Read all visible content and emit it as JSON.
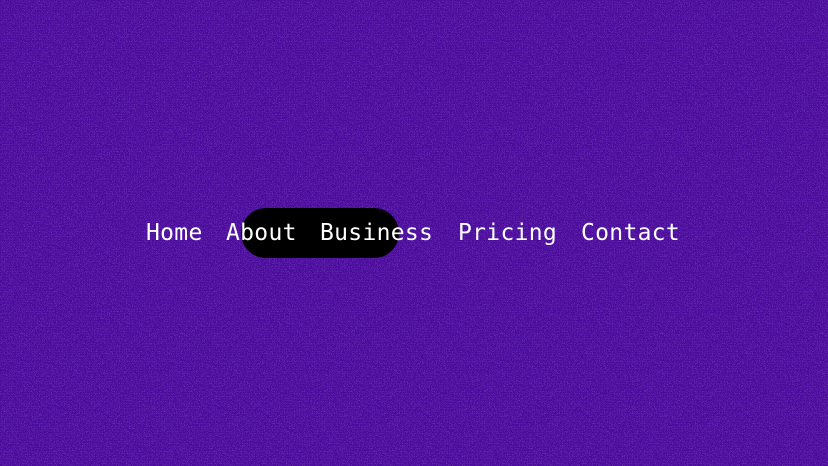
{
  "theme": {
    "background": "#4a0a9c",
    "highlight": "#000000",
    "text": "#ffffff"
  },
  "nav": {
    "items": [
      {
        "label": "Home"
      },
      {
        "label": "About"
      },
      {
        "label": "Business"
      },
      {
        "label": "Pricing"
      },
      {
        "label": "Contact"
      }
    ]
  }
}
